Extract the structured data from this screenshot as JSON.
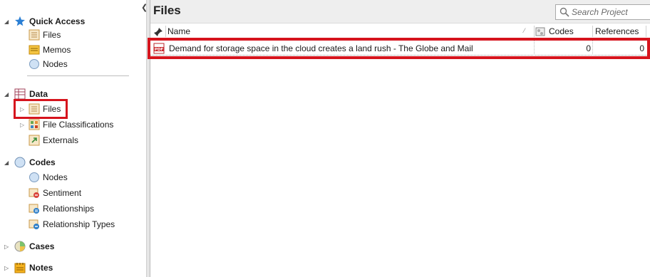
{
  "navigation": {
    "quick_access": {
      "label": "Quick Access",
      "items": [
        {
          "label": "Files",
          "icon": "files-icon"
        },
        {
          "label": "Memos",
          "icon": "memos-icon"
        },
        {
          "label": "Nodes",
          "icon": "nodes-icon"
        }
      ]
    },
    "data": {
      "label": "Data",
      "items": [
        {
          "label": "Files",
          "icon": "files-icon"
        },
        {
          "label": "File Classifications",
          "icon": "file-classifications-icon"
        },
        {
          "label": "Externals",
          "icon": "externals-icon"
        }
      ]
    },
    "codes": {
      "label": "Codes",
      "items": [
        {
          "label": "Nodes",
          "icon": "nodes-icon"
        },
        {
          "label": "Sentiment",
          "icon": "sentiment-icon"
        },
        {
          "label": "Relationships",
          "icon": "relationships-icon"
        },
        {
          "label": "Relationship Types",
          "icon": "relationship-types-icon"
        }
      ]
    },
    "cases": {
      "label": "Cases"
    },
    "notes": {
      "label": "Notes"
    }
  },
  "main": {
    "title": "Files",
    "search": {
      "placeholder": "Search Project",
      "value": ""
    },
    "columns": {
      "name": "Name",
      "codes": "Codes",
      "references": "References"
    },
    "rows": [
      {
        "name": "Demand for storage space in the cloud creates a land rush - The Globe and Mail",
        "codes": "0",
        "references": "0",
        "type_icon": "pdf-icon"
      }
    ]
  },
  "colors": {
    "highlight": "#d6141d",
    "quick_access_star": "#2b7fd4",
    "title_bar": "#eeeeee"
  }
}
